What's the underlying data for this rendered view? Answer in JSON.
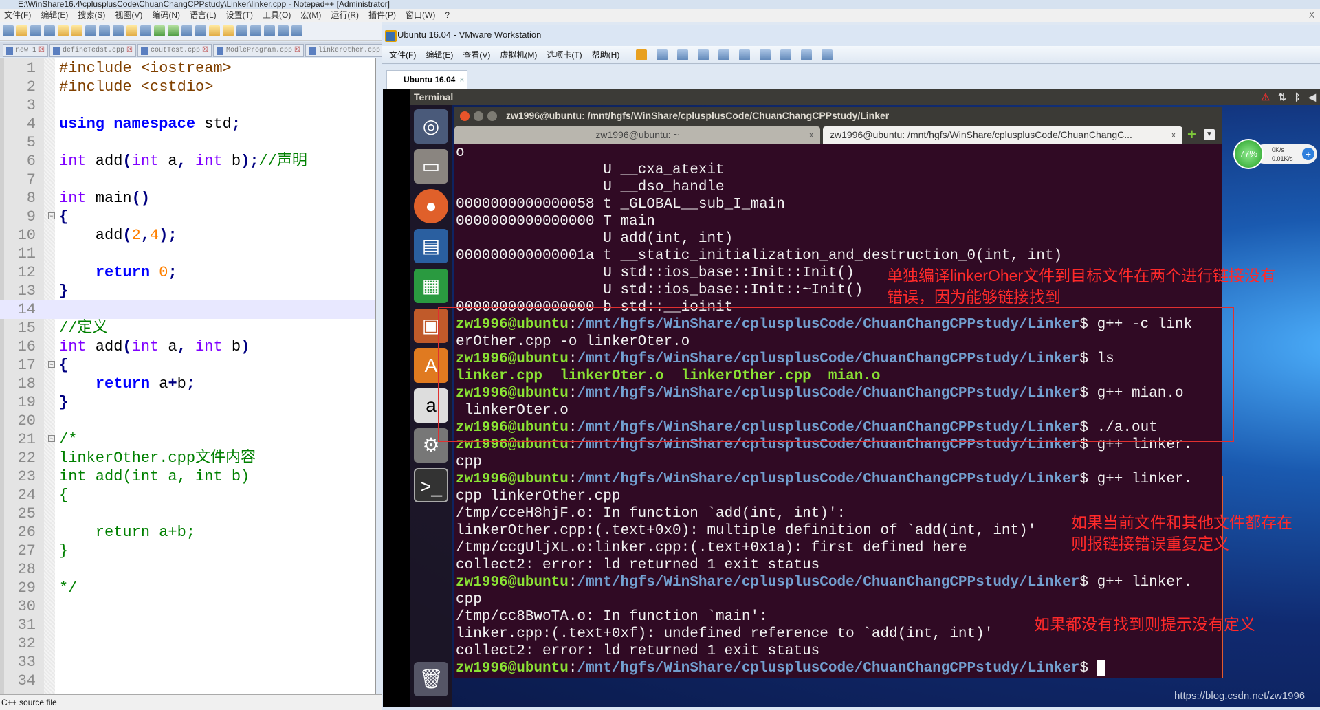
{
  "notepad": {
    "title": "E:\\WinShare16.4\\cplusplusCode\\ChuanChangCPPstudy\\Linker\\linker.cpp - Notepad++ [Administrator]",
    "menu": [
      "文件(F)",
      "编辑(E)",
      "搜索(S)",
      "视图(V)",
      "编码(N)",
      "语言(L)",
      "设置(T)",
      "工具(O)",
      "宏(M)",
      "运行(R)",
      "插件(P)",
      "窗口(W)",
      "?"
    ],
    "close": "X",
    "tabs": [
      "new 1",
      "defineTedst.cpp",
      "coutTest.cpp",
      "ModleProgram.cpp",
      "linkerOther.cpp"
    ],
    "status": "C++ source file",
    "code": [
      [
        [
          "pp",
          "#include <iostream>"
        ]
      ],
      [
        [
          "pp",
          "#include <cstdio>"
        ]
      ],
      [],
      [
        [
          "kw",
          "using"
        ],
        [
          "tx",
          " "
        ],
        [
          "kw",
          "namespace"
        ],
        [
          "tx",
          " std"
        ],
        [
          "op",
          ";"
        ]
      ],
      [],
      [
        [
          "ty",
          "int"
        ],
        [
          "tx",
          " add"
        ],
        [
          "op",
          "("
        ],
        [
          "ty",
          "int"
        ],
        [
          "tx",
          " a"
        ],
        [
          "op",
          ","
        ],
        [
          "tx",
          " "
        ],
        [
          "ty",
          "int"
        ],
        [
          "tx",
          " b"
        ],
        [
          "op",
          ");"
        ],
        [
          "cm",
          "//声明"
        ]
      ],
      [],
      [
        [
          "ty",
          "int"
        ],
        [
          "tx",
          " main"
        ],
        [
          "op",
          "()"
        ]
      ],
      [
        [
          "op",
          "{"
        ]
      ],
      [
        [
          "tx",
          "    add"
        ],
        [
          "op",
          "("
        ],
        [
          "nu",
          "2"
        ],
        [
          "op",
          ","
        ],
        [
          "nu",
          "4"
        ],
        [
          "op",
          ");"
        ]
      ],
      [],
      [
        [
          "tx",
          "    "
        ],
        [
          "kw",
          "return"
        ],
        [
          "tx",
          " "
        ],
        [
          "nu",
          "0"
        ],
        [
          "op",
          ";"
        ]
      ],
      [
        [
          "op",
          "}"
        ]
      ],
      [],
      [
        [
          "cm",
          "//定义"
        ]
      ],
      [
        [
          "ty",
          "int"
        ],
        [
          "tx",
          " add"
        ],
        [
          "op",
          "("
        ],
        [
          "ty",
          "int"
        ],
        [
          "tx",
          " a"
        ],
        [
          "op",
          ","
        ],
        [
          "tx",
          " "
        ],
        [
          "ty",
          "int"
        ],
        [
          "tx",
          " b"
        ],
        [
          "op",
          ")"
        ]
      ],
      [
        [
          "op",
          "{"
        ]
      ],
      [
        [
          "tx",
          "    "
        ],
        [
          "kw",
          "return"
        ],
        [
          "tx",
          " a"
        ],
        [
          "op",
          "+"
        ],
        [
          "tx",
          "b"
        ],
        [
          "op",
          ";"
        ]
      ],
      [
        [
          "op",
          "}"
        ]
      ],
      [],
      [
        [
          "cm",
          "/*"
        ]
      ],
      [
        [
          "cm",
          "linkerOther.cpp文件内容"
        ]
      ],
      [
        [
          "cm",
          "int add(int a, int b)"
        ]
      ],
      [
        [
          "cm",
          "{"
        ]
      ],
      [],
      [
        [
          "cm",
          "    return a+b;"
        ]
      ],
      [
        [
          "cm",
          "}"
        ]
      ],
      [],
      [
        [
          "cm",
          "*/"
        ]
      ],
      [],
      [],
      [],
      [],
      []
    ],
    "current_line": 14,
    "fold_lines": [
      9,
      17,
      21
    ]
  },
  "vmware": {
    "title": "Ubuntu 16.04 - VMware Workstation",
    "menu": [
      "文件(F)",
      "编辑(E)",
      "查看(V)",
      "虚拟机(M)",
      "选项卡(T)",
      "帮助(H)"
    ],
    "tab": "Ubuntu 16.04",
    "tab_close": "×"
  },
  "ubuntu": {
    "topbar": "Terminal",
    "net": {
      "percent": "77%",
      "up": "0K/s",
      "down": "0.01K/s"
    },
    "terminal": {
      "title": "zw1996@ubuntu: /mnt/hgfs/WinShare/cplusplusCode/ChuanChangCPPstudy/Linker",
      "tabs": [
        "zw1996@ubuntu: ~",
        "zw1996@ubuntu: /mnt/hgfs/WinShare/cplusplusCode/ChuanChangC..."
      ],
      "tab_close": "x",
      "lines": [
        [
          [
            "w",
            "o"
          ]
        ],
        [
          [
            "w",
            "                 U __cxa_atexit"
          ]
        ],
        [
          [
            "w",
            "                 U __dso_handle"
          ]
        ],
        [
          [
            "w",
            "0000000000000058 t _GLOBAL__sub_I_main"
          ]
        ],
        [
          [
            "w",
            "0000000000000000 T main"
          ]
        ],
        [
          [
            "w",
            "                 U add(int, int)"
          ]
        ],
        [
          [
            "w",
            "000000000000001a t __static_initialization_and_destruction_0(int, int)"
          ]
        ],
        [
          [
            "w",
            "                 U std::ios_base::Init::Init()"
          ]
        ],
        [
          [
            "w",
            "                 U std::ios_base::Init::~Init()"
          ]
        ],
        [
          [
            "w",
            "0000000000000000 b std::__ioinit"
          ]
        ],
        [
          [
            "g",
            "zw1996@ubuntu"
          ],
          [
            "w",
            ":"
          ],
          [
            "b",
            "/mnt/hgfs/WinShare/cplusplusCode/ChuanChangCPPstudy/Linker"
          ],
          [
            "w",
            "$ g++ -c link"
          ]
        ],
        [
          [
            "w",
            "erOther.cpp -o linkerOter.o"
          ]
        ],
        [
          [
            "g",
            "zw1996@ubuntu"
          ],
          [
            "w",
            ":"
          ],
          [
            "b",
            "/mnt/hgfs/WinShare/cplusplusCode/ChuanChangCPPstudy/Linker"
          ],
          [
            "w",
            "$ ls"
          ]
        ],
        [
          [
            "gr",
            "linker.cpp  linkerOter.o  linkerOther.cpp  mian.o"
          ]
        ],
        [
          [
            "g",
            "zw1996@ubuntu"
          ],
          [
            "w",
            ":"
          ],
          [
            "b",
            "/mnt/hgfs/WinShare/cplusplusCode/ChuanChangCPPstudy/Linker"
          ],
          [
            "w",
            "$ g++ mian.o"
          ]
        ],
        [
          [
            "w",
            " linkerOter.o"
          ]
        ],
        [
          [
            "g",
            "zw1996@ubuntu"
          ],
          [
            "w",
            ":"
          ],
          [
            "b",
            "/mnt/hgfs/WinShare/cplusplusCode/ChuanChangCPPstudy/Linker"
          ],
          [
            "w",
            "$ ./a.out"
          ]
        ],
        [
          [
            "g",
            "zw1996@ubuntu"
          ],
          [
            "w",
            ":"
          ],
          [
            "b",
            "/mnt/hgfs/WinShare/cplusplusCode/ChuanChangCPPstudy/Linker"
          ],
          [
            "w",
            "$ g++ linker."
          ]
        ],
        [
          [
            "w",
            "cpp"
          ]
        ],
        [
          [
            "g",
            "zw1996@ubuntu"
          ],
          [
            "w",
            ":"
          ],
          [
            "b",
            "/mnt/hgfs/WinShare/cplusplusCode/ChuanChangCPPstudy/Linker"
          ],
          [
            "w",
            "$ g++ linker."
          ]
        ],
        [
          [
            "w",
            "cpp linkerOther.cpp"
          ]
        ],
        [
          [
            "w",
            "/tmp/cceH8hjF.o: In function `add(int, int)':"
          ]
        ],
        [
          [
            "w",
            "linkerOther.cpp:(.text+0x0): multiple definition of `add(int, int)'"
          ]
        ],
        [
          [
            "w",
            "/tmp/ccgUljXL.o:linker.cpp:(.text+0x1a): first defined here"
          ]
        ],
        [
          [
            "w",
            "collect2: error: ld returned 1 exit status"
          ]
        ],
        [
          [
            "g",
            "zw1996@ubuntu"
          ],
          [
            "w",
            ":"
          ],
          [
            "b",
            "/mnt/hgfs/WinShare/cplusplusCode/ChuanChangCPPstudy/Linker"
          ],
          [
            "w",
            "$ g++ linker."
          ]
        ],
        [
          [
            "w",
            "cpp"
          ]
        ],
        [
          [
            "w",
            "/tmp/cc8BwoTA.o: In function `main':"
          ]
        ],
        [
          [
            "w",
            "linker.cpp:(.text+0xf): undefined reference to `add(int, int)'"
          ]
        ],
        [
          [
            "w",
            "collect2: error: ld returned 1 exit status"
          ]
        ],
        [
          [
            "g",
            "zw1996@ubuntu"
          ],
          [
            "w",
            ":"
          ],
          [
            "b",
            "/mnt/hgfs/WinShare/cplusplusCode/ChuanChangCPPstudy/Linker"
          ],
          [
            "w",
            "$ "
          ]
        ]
      ]
    }
  },
  "annotations": {
    "a1": [
      "单独编译linkerOher文件到目标文件在两个进行链接没有",
      "错误，因为能够链接找到"
    ],
    "a2": [
      "如果当前文件和其他文件都存在",
      "则报链接错误重复定义"
    ],
    "a3": "如果都没有找到则提示没有定义",
    "color": "#ff2a2a"
  },
  "watermark": "https://blog.csdn.net/zw1996"
}
